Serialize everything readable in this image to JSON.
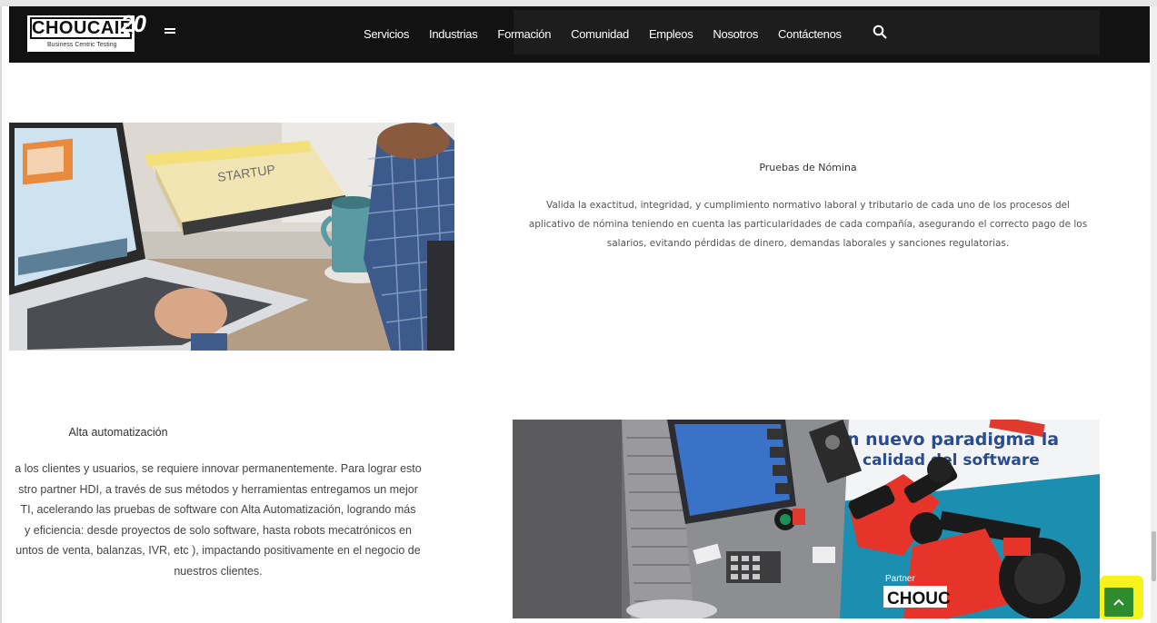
{
  "logo": {
    "word": "CHOUCAIR",
    "tagline": "Business Centric Testing",
    "anniversary": "20"
  },
  "nav": {
    "items": [
      "Servicios",
      "Industrias",
      "Formación",
      "Comunidad",
      "Empleos",
      "Nosotros",
      "Contáctenos"
    ]
  },
  "section1": {
    "title": "Pruebas de Nómina",
    "body_lines": [
      "Valida la exactitud, integridad, y cumplimiento normativo laboral y tributario de cada uno de los procesos del",
      "aplicativo de nómina teniendo en cuenta las particularidades de cada compañía, asegurando el correcto pago de los",
      "salarios, evitando pérdidas de dinero, demandas laborales y sanciones regulatorias."
    ]
  },
  "section2": {
    "title": "Alta automatización",
    "body_lines": [
      "a los clientes y usuarios, se requiere innovar permanentemente. Para lograr esto",
      "stro partner HDI, a través de sus métodos y herramientas entregamos un mejor",
      "TI, acelerando las pruebas de software con Alta Automatización, logrando más",
      "y eficiencia: desde proyectos de solo software, hasta robots mecatrónicos en",
      "untos de venta, balanzas, IVR, etc ), impactando positivamente en el negocio de",
      "nuestros clientes."
    ]
  },
  "image2": {
    "banner_line1": "n nuevo paradigma la",
    "banner_line2": "calidad del software",
    "partner_label": "Partner",
    "partner_logo": "CHOUC"
  },
  "colors": {
    "header_bg": "#121212",
    "totop_bg": "#2e8b2e",
    "highlight": "#f5f31a"
  },
  "icons": {
    "search": "search-icon",
    "to_top": "chevron-up-icon"
  }
}
